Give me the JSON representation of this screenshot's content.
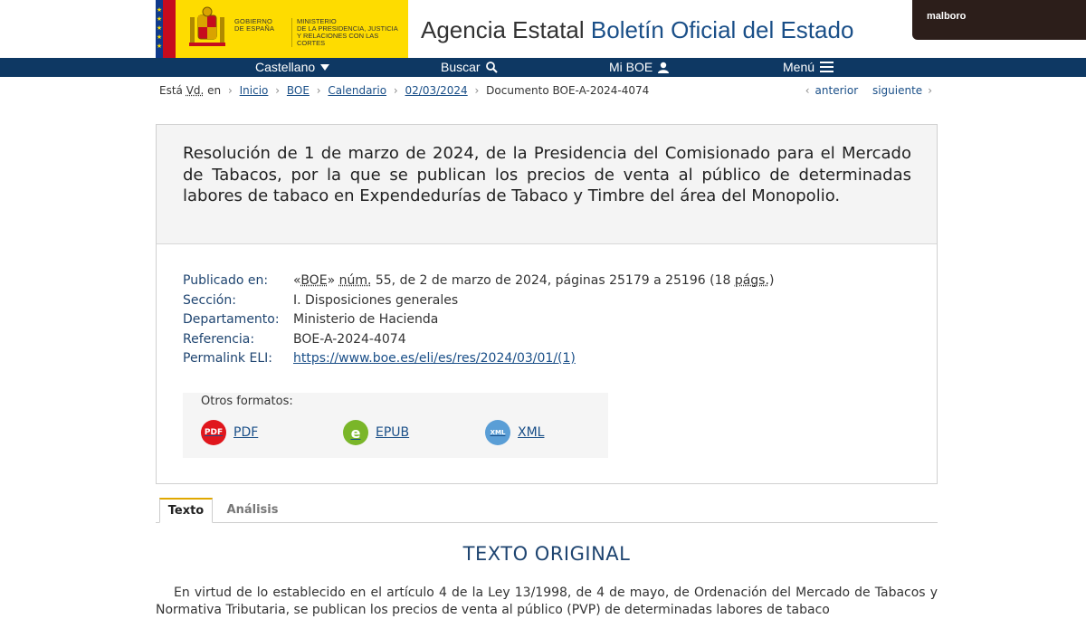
{
  "header": {
    "gov_line1": "GOBIERNO",
    "gov_line2": "DE ESPAÑA",
    "ministry_line1": "MINISTERIO",
    "ministry_line2": "DE LA PRESIDENCIA, JUSTICIA",
    "ministry_line3": "Y RELACIONES CON LAS CORTES",
    "title_prefix": "Agencia Estatal",
    "title_accent": "Boletín Oficial del Estado",
    "user_label": "malboro"
  },
  "nav": {
    "language": "Castellano",
    "search": "Buscar",
    "my_boe": "Mi BOE",
    "menu": "Menú"
  },
  "breadcrumb": {
    "you_are_a": "Está ",
    "you_are_abbr": "Vd.",
    "you_are_b": " en",
    "items": [
      "Inicio",
      "BOE",
      "Calendario",
      "02/03/2024"
    ],
    "current": "Documento BOE-A-2024-4074"
  },
  "pager": {
    "previous": "anterior",
    "next": "siguiente"
  },
  "document": {
    "title": "Resolución de 1 de marzo de 2024, de la Presidencia del Comisionado para el Mercado de Tabacos, por la que se publican los precios de venta al público de determinadas labores de tabaco en Expendedurías de Tabaco y Timbre del área del Monopolio.",
    "meta": {
      "published_label": "Publicado en:",
      "published_a": "«",
      "published_boe": "BOE",
      "published_b": "» ",
      "published_num": "núm.",
      "published_c": " 55, de 2 de marzo de 2024, páginas 25179 a 25196 (18 ",
      "published_pags": "págs.",
      "published_d": ")",
      "section_label": "Sección:",
      "section_value": "I. Disposiciones generales",
      "department_label": "Departamento:",
      "department_value": "Ministerio de Hacienda",
      "reference_label": "Referencia:",
      "reference_value": "BOE-A-2024-4074",
      "permalink_label": "Permalink ELI:",
      "permalink_value": "https://www.boe.es/eli/es/res/2024/03/01/(1)"
    },
    "formats": {
      "label": "Otros formatos:",
      "items": [
        {
          "label": "PDF",
          "icon": "pdf-icon",
          "color": "#e0161c",
          "glyph": "PDF"
        },
        {
          "label": "EPUB",
          "icon": "epub-icon",
          "color": "#7ab629",
          "glyph": "e"
        },
        {
          "label": "XML",
          "icon": "xml-icon",
          "color": "#5a9ed6",
          "glyph": "XML"
        }
      ]
    }
  },
  "tabs": [
    "Texto",
    "Análisis"
  ],
  "content": {
    "heading": "TEXTO ORIGINAL",
    "paragraph": "En virtud de lo establecido en el artículo 4 de la Ley 13/1998, de 4 de mayo, de Ordenación del Mercado de Tabacos y Normativa Tributaria, se publican los precios de venta al público (PVP) de determinadas labores de tabaco"
  },
  "colors": {
    "navbar": "#0e3863",
    "accent": "#1a4f88",
    "gov_yellow": "#fedc00",
    "tab_highlight": "#e0a800"
  }
}
